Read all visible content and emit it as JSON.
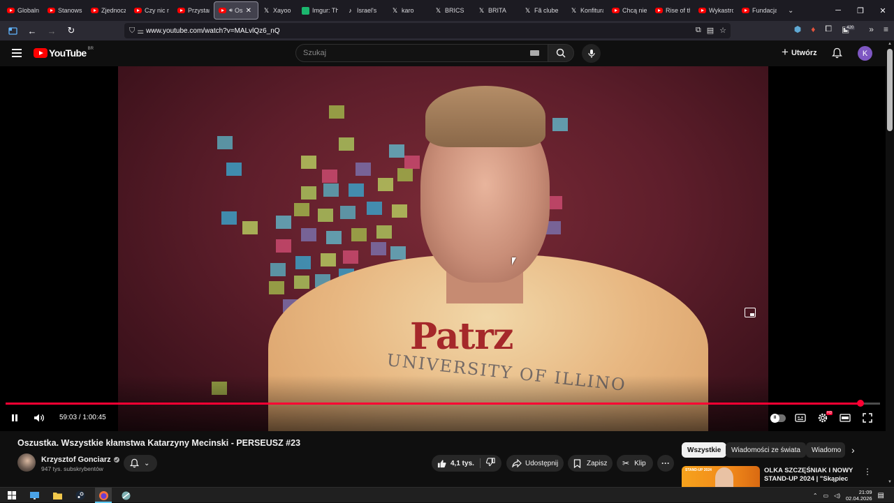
{
  "browser": {
    "tabs": [
      {
        "label": "Globalne",
        "icon": "youtube-icon"
      },
      {
        "label": "Stanowsk",
        "icon": "youtube-icon"
      },
      {
        "label": "Zjednocz",
        "icon": "youtube-icon"
      },
      {
        "label": "Czy nic n",
        "icon": "youtube-icon"
      },
      {
        "label": "Przystane",
        "icon": "youtube-icon"
      },
      {
        "label": "Os",
        "icon": "youtube-icon",
        "active": true
      },
      {
        "label": "Xayoo",
        "icon": "x-icon"
      },
      {
        "label": "Imgur: Th",
        "icon": "imgur-icon"
      },
      {
        "label": "Israel's",
        "icon": "tiktok-icon"
      },
      {
        "label": "karo",
        "icon": "x-icon"
      },
      {
        "label": "BRICS",
        "icon": "x-icon"
      },
      {
        "label": "BRITA",
        "icon": "x-icon"
      },
      {
        "label": "Fã clube",
        "icon": "x-icon"
      },
      {
        "label": "Konfitura",
        "icon": "x-icon"
      },
      {
        "label": "Chcą niel",
        "icon": "youtube-icon"
      },
      {
        "label": "Rise of th",
        "icon": "youtube-icon"
      },
      {
        "label": "Wykastro",
        "icon": "youtube-icon"
      },
      {
        "label": "Fundacja",
        "icon": "youtube-icon"
      }
    ],
    "url": "www.youtube.com/watch?v=MALvlQz6_nQ",
    "extension_badge": "420"
  },
  "youtube": {
    "logo_text": "YouTube",
    "country_code": "BR",
    "search_placeholder": "Szukaj",
    "create_label": "Utwórz",
    "avatar_letter": "K"
  },
  "player": {
    "current_time": "59:03",
    "duration": "1:00:45",
    "time_display": "59:03 / 1:00:45",
    "progress_fraction": 0.978,
    "shirt_text": "Patrz",
    "shirt_arc_text": "UNIVERSITY OF ILLINO"
  },
  "video": {
    "title": "Oszustka. Wszystkie kłamstwa Katarzyny Mecinski - PERSEUSZ #23",
    "channel": "Krzysztof Gonciarz",
    "subscribers": "947 tys. subskrybentów",
    "likes": "4,1 tys.",
    "share_label": "Udostępnij",
    "save_label": "Zapisz",
    "clip_label": "Klip"
  },
  "sidebar": {
    "chips": [
      "Wszystkie",
      "Wiadomości ze świata",
      "Wiadomo"
    ],
    "recommendation": {
      "title": "OLKA SZCZĘŚNIAK I NOWY STAND-UP 2024 | \"Skąpiec ...",
      "thumb_tag": "STAND-UP 2024"
    }
  },
  "taskbar": {
    "time": "21:09",
    "date": "02.04.2026"
  },
  "colors": {
    "accent": "#ff0033",
    "background": "#0f0f0f",
    "avatar": "#7e57c2"
  }
}
